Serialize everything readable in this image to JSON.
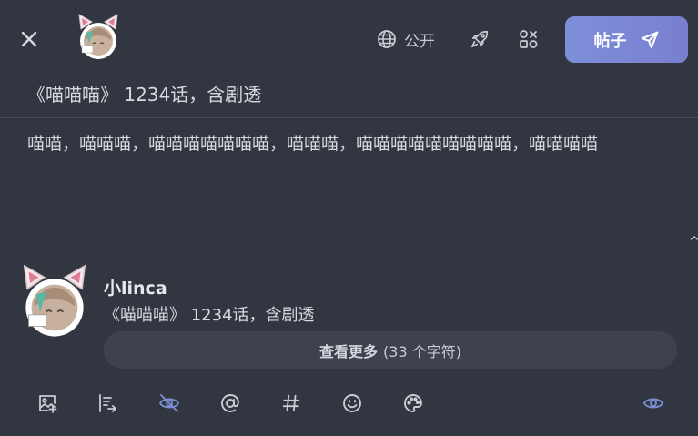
{
  "header": {
    "visibility_label": "公开",
    "post_label": "帖子"
  },
  "editor": {
    "title": "《喵喵喵》 1234话，含剧透",
    "body": "喵喵，喵喵喵，喵喵喵喵喵喵喵，喵喵喵，喵喵喵喵喵喵喵喵喵，喵喵喵喵"
  },
  "preview": {
    "username": "小linca",
    "title": "《喵喵喵》 1234话，含剧透",
    "see_more_label": "查看更多",
    "char_count": "(33 个字符)"
  },
  "toolbar": {
    "icons": [
      "add-image-icon",
      "share-to-icon",
      "spoiler-hide-icon",
      "mention-icon",
      "hashtag-icon",
      "emoji-icon",
      "palette-icon",
      "preview-eye-icon"
    ]
  },
  "colors": {
    "background": "#323641",
    "accent": "#7d8fd8",
    "active_icon": "#7b8fd4",
    "pill": "#3d424e"
  }
}
